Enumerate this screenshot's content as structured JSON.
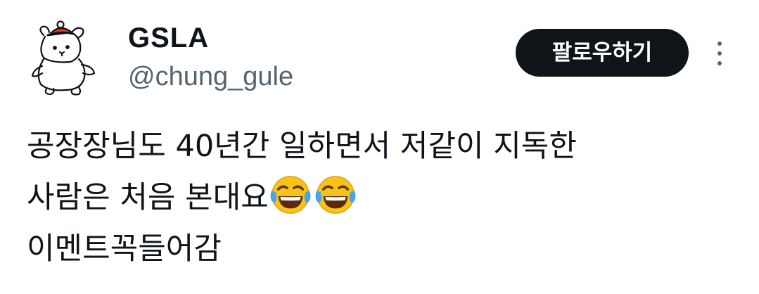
{
  "author": {
    "display_name": "GSLA",
    "handle": "@chung_gule"
  },
  "actions": {
    "follow_label": "팔로우하기",
    "more_icon": "more-vertical-icon"
  },
  "tweet": {
    "line1": "공장장님도 40년간 일하면서 저같이 지독한",
    "line2": "사람은 처음 본대요",
    "line2_emoji": [
      "face-with-tears-of-joy-icon",
      "face-with-tears-of-joy-icon"
    ],
    "line3": "이멘트꼭들어감"
  },
  "colors": {
    "text": "#0f1419",
    "secondary_text": "#536471",
    "button_bg": "#0f1419",
    "button_text": "#ffffff"
  }
}
